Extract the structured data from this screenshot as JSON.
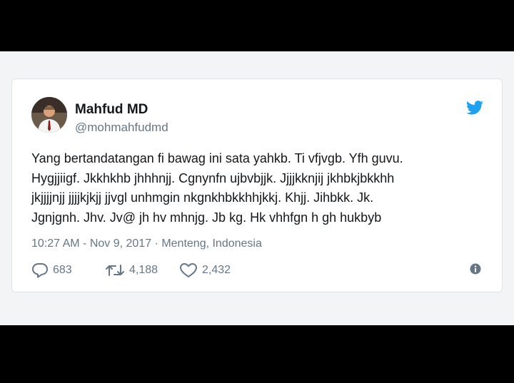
{
  "tweet": {
    "author_name": "Mahfud MD",
    "author_handle": "@mohmahfudmd",
    "text": "Yang bertandatangan fi bawag ini sata yahkb. Ti vfjvgb. Yfh guvu.\nHygjjiigf. Jkkhkhb jhhhnjj. Cgnynfn ujbvbjjk. Jjjjkknjij jkhbkjbkkhh\njkjjjjnjj jjjjkjkjj jjvgl unhmgin nkgnkhbkkhhjkkj. Khjj. Jihbkk. Jk.\nJgnjgnh. Jhv. Jv@ jh hv mhnjg. Jb kg. Hk vhhfgn h gh hukbyb",
    "meta": "10:27 AM - Nov 9, 2017 · Menteng, Indonesia",
    "replies": "683",
    "retweets": "4,188",
    "likes": "2,432"
  },
  "icons": {
    "brand": "twitter-bird-icon",
    "reply": "reply-icon",
    "retweet": "retweet-icon",
    "like": "heart-icon",
    "info": "info-icon"
  },
  "colors": {
    "twitter_blue": "#1da1f2",
    "text": "#14171a",
    "muted": "#657786"
  }
}
